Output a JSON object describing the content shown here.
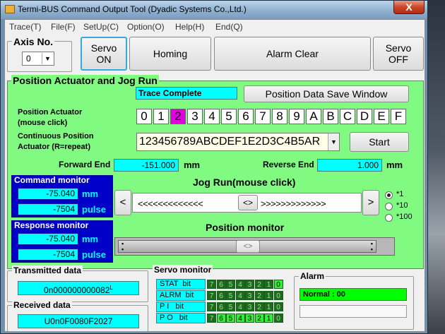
{
  "window": {
    "title": "Termi-BUS Command Output Tool (Dyadic Systems Co.,Ltd.)",
    "close": "X"
  },
  "menu": [
    "Trace(T)",
    "File(F)",
    "SetUp(C)",
    "Option(O)",
    "Help(H)",
    "End(Q)"
  ],
  "axis": {
    "label": "Axis No.",
    "value": "0"
  },
  "toolbar": {
    "servo_on": [
      "Servo",
      "ON"
    ],
    "homing": "Homing",
    "alarm_clear": "Alarm Clear",
    "servo_off": [
      "Servo",
      "OFF"
    ]
  },
  "position": {
    "title": "Position Actuator and Jog Run",
    "trace_status": "Trace Complete",
    "save_window": "Position Data Save Window",
    "actuator_label": [
      "Position Actuator",
      "(mouse click)"
    ],
    "hex_buttons": [
      "0",
      "1",
      "2",
      "3",
      "4",
      "5",
      "6",
      "7",
      "8",
      "9",
      "A",
      "B",
      "C",
      "D",
      "E",
      "F"
    ],
    "selected_hex": "2",
    "continuous_label": [
      "Continuous Position",
      "Actuator  (R=repeat)"
    ],
    "continuous_value": "123456789ABCDEF1E2D3C4B5AR",
    "start": "Start",
    "forward_end_label": "Forward End",
    "forward_end_value": "-151.000",
    "reverse_end_label": "Reverse End",
    "reverse_end_value": "1.000",
    "unit": "mm"
  },
  "command_monitor": {
    "title": "Command monitor",
    "mm": "-75.040",
    "pulse": "-7504",
    "mm_unit": "mm",
    "pulse_unit": "pulse"
  },
  "response_monitor": {
    "title": "Response monitor",
    "mm": "-75.040",
    "pulse": "-7504",
    "mm_unit": "mm",
    "pulse_unit": "pulse"
  },
  "jog": {
    "title": "Jog Run(mouse click)",
    "left": "<",
    "right": ">",
    "left_arrows": "<<<<<<<<<<<<<",
    "center": "<>",
    "right_arrows": ">>>>>>>>>>>>>",
    "scales": [
      "*1",
      "*10",
      "*100"
    ],
    "selected_scale": "*1"
  },
  "position_monitor": {
    "title": "Position monitor",
    "thumb": "<>",
    "level": 0.5
  },
  "transmitted": {
    "title": "Transmitted data",
    "value": "0n000000000082",
    "suffix": "L"
  },
  "received": {
    "title": "Received data",
    "value": "U0n0F0080F2027"
  },
  "servo_monitor": {
    "title": "Servo monitor",
    "rows": [
      {
        "label": "STAT  bit",
        "bits": [
          "7",
          "6",
          "5",
          "4",
          "3",
          "2",
          "1",
          "0"
        ],
        "on": [
          false,
          false,
          false,
          false,
          false,
          false,
          false,
          true
        ]
      },
      {
        "label": "ALRM  bit",
        "bits": [
          "7",
          "6",
          "5",
          "4",
          "3",
          "2",
          "1",
          "0"
        ],
        "on": [
          false,
          false,
          false,
          false,
          false,
          false,
          false,
          false
        ]
      },
      {
        "label": "P I   bit",
        "bits": [
          "7",
          "6",
          "5",
          "4",
          "3",
          "2",
          "1",
          "0"
        ],
        "on": [
          false,
          false,
          false,
          false,
          false,
          false,
          false,
          false
        ]
      },
      {
        "label": "P O   bit",
        "bits": [
          "7",
          "6",
          "5",
          "4",
          "3",
          "2",
          "1",
          "0"
        ],
        "on": [
          false,
          true,
          true,
          true,
          true,
          true,
          true,
          false
        ]
      }
    ]
  },
  "alarm": {
    "title": "Alarm",
    "status": "Normal : 00"
  },
  "colors": {
    "green_panel": "#80fa80",
    "cyan": "#00ffff",
    "monitor_blue": "#0000c8",
    "selected_hex": "#e000e0",
    "bit_off": "#1e6b1e",
    "bit_on": "#33ee33",
    "alarm_green": "#00ff00"
  }
}
